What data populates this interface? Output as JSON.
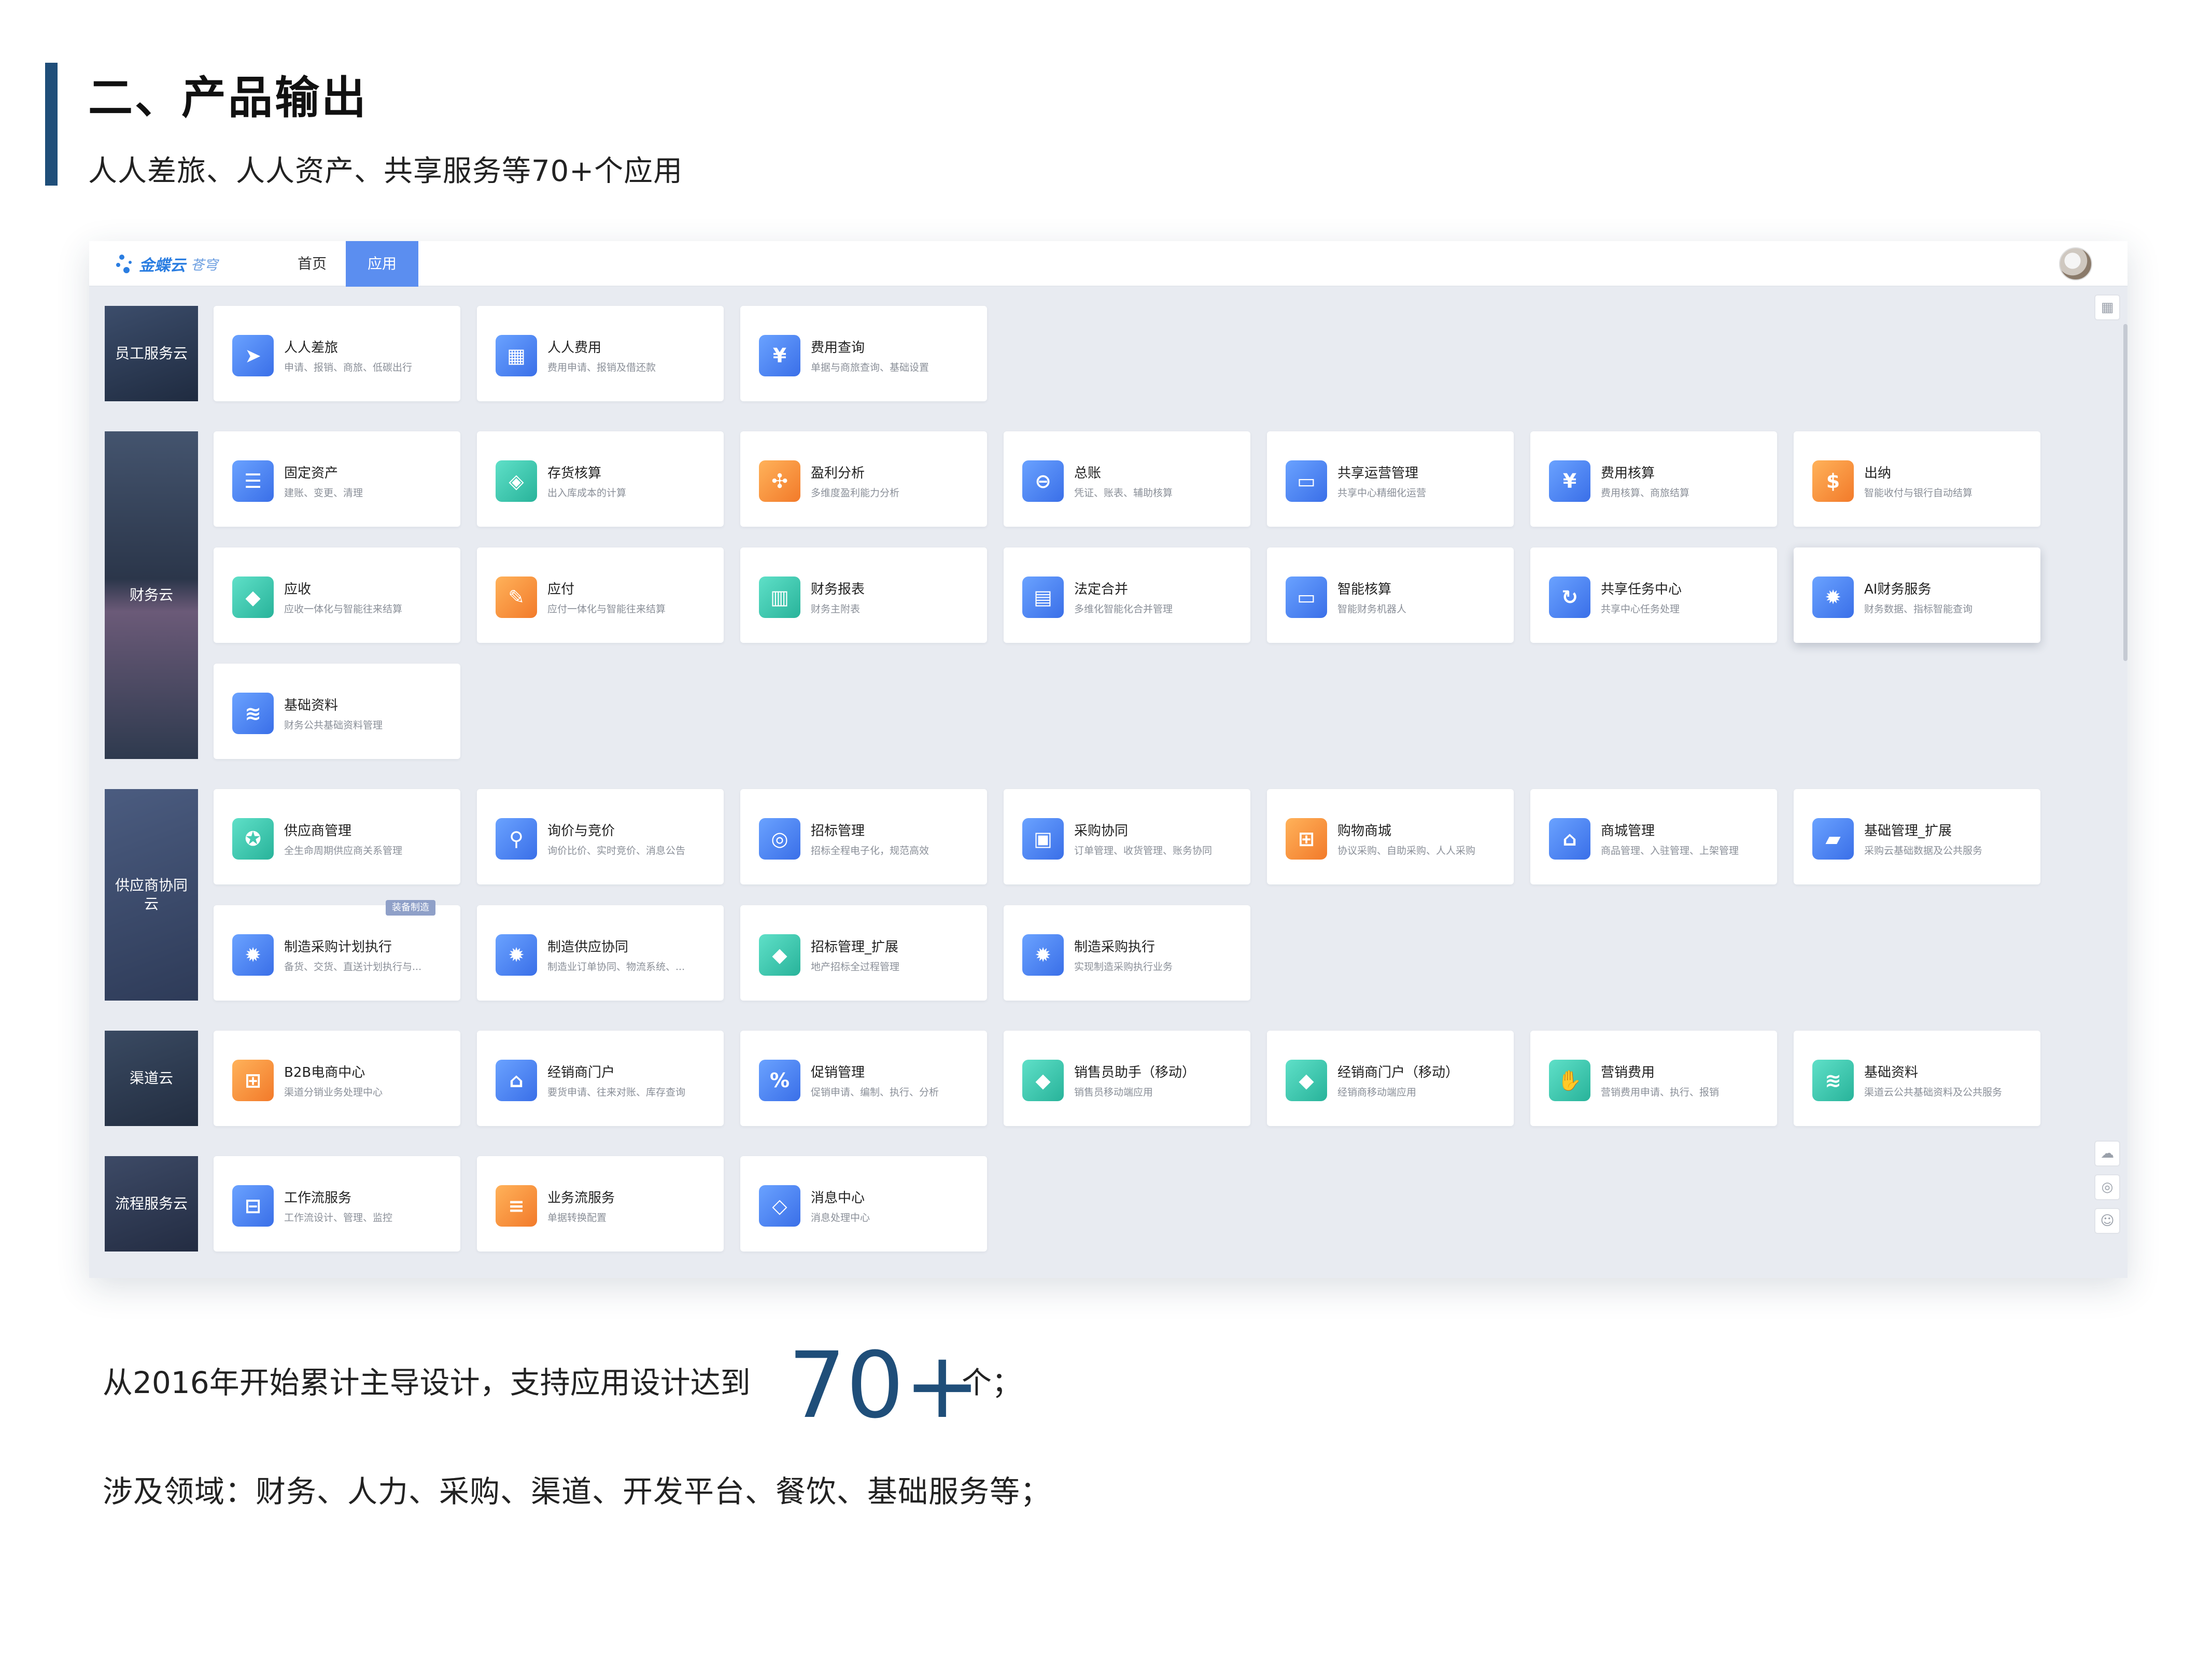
{
  "slide": {
    "title": "二、产品输出",
    "subtitle": "人人差旅、人人资产、共享服务等70+个应用"
  },
  "app": {
    "logo_text": "金蝶云",
    "logo_sub": "苍穹",
    "nav": {
      "home": "首页",
      "apps": "应用"
    },
    "accent_color": "#5b8ef0"
  },
  "sections": [
    {
      "label": "员工服务云",
      "cards": [
        {
          "name": "人人差旅",
          "desc": "申请、报销、商旅、低碳出行",
          "icon": "travel-icon",
          "color": "blue"
        },
        {
          "name": "人人费用",
          "desc": "费用申请、报销及借还款",
          "icon": "calculator-icon",
          "color": "blue"
        },
        {
          "name": "费用查询",
          "desc": "单据与商旅查询、基础设置",
          "icon": "document-yen-icon",
          "color": "blue"
        }
      ]
    },
    {
      "label": "财务云",
      "cards": [
        {
          "name": "固定资产",
          "desc": "建账、变更、清理",
          "icon": "list-icon",
          "color": "blue"
        },
        {
          "name": "存货核算",
          "desc": "出入库成本的计算",
          "icon": "box-icon",
          "color": "green"
        },
        {
          "name": "盈利分析",
          "desc": "多维度盈利能力分析",
          "icon": "network-icon",
          "color": "orange"
        },
        {
          "name": "总账",
          "desc": "凭证、账表、辅助核算",
          "icon": "ledger-icon",
          "color": "blue"
        },
        {
          "name": "共享运营管理",
          "desc": "共享中心精细化运营",
          "icon": "monitor-icon",
          "color": "blue"
        },
        {
          "name": "费用核算",
          "desc": "费用核算、商旅结算",
          "icon": "document-yen-icon",
          "color": "blue"
        },
        {
          "name": "出纳",
          "desc": "智能收付与银行自动结算",
          "icon": "money-bag-icon",
          "color": "orange"
        },
        {
          "name": "应收",
          "desc": "应收一体化与智能往来结算",
          "icon": "cube-icon",
          "color": "green"
        },
        {
          "name": "应付",
          "desc": "应付一体化与智能往来结算",
          "icon": "pen-paper-icon",
          "color": "orange"
        },
        {
          "name": "财务报表",
          "desc": "财务主附表",
          "icon": "chart-board-icon",
          "color": "green"
        },
        {
          "name": "法定合并",
          "desc": "多维化智能化合并管理",
          "icon": "report-icon",
          "color": "blue"
        },
        {
          "name": "智能核算",
          "desc": "智能财务机器人",
          "icon": "monitor-icon",
          "color": "blue"
        },
        {
          "name": "共享任务中心",
          "desc": "共享中心任务处理",
          "icon": "cycle-icon",
          "color": "blue"
        },
        {
          "name": "AI财务服务",
          "desc": "财务数据、指标智能查询",
          "icon": "gear-icon",
          "color": "blue"
        },
        {
          "name": "基础资料",
          "desc": "财务公共基础资料管理",
          "icon": "layers-icon",
          "color": "blue"
        }
      ]
    },
    {
      "label": "供应商协同云",
      "cards": [
        {
          "name": "供应商管理",
          "desc": "全生命周期供应商关系管理",
          "icon": "award-icon",
          "color": "green"
        },
        {
          "name": "询价与竞价",
          "desc": "询价比价、实时竞价、消息公告",
          "icon": "search-icon",
          "color": "blue"
        },
        {
          "name": "招标管理",
          "desc": "招标全程电子化，规范高效",
          "icon": "target-icon",
          "color": "blue"
        },
        {
          "name": "采购协同",
          "desc": "订单管理、收货管理、账务协同",
          "icon": "cart-board-icon",
          "color": "blue"
        },
        {
          "name": "购物商城",
          "desc": "协议采购、自助采购、人人采购",
          "icon": "cart-icon",
          "color": "orange"
        },
        {
          "name": "商城管理",
          "desc": "商品管理、入驻管理、上架管理",
          "icon": "store-icon",
          "color": "blue"
        },
        {
          "name": "基础管理_扩展",
          "desc": "采购云基础数据及公共服务",
          "icon": "folder-icon",
          "color": "blue"
        },
        {
          "name": "制造采购计划执行",
          "desc": "备货、交货、直送计划执行与...",
          "icon": "gear-icon",
          "color": "blue",
          "badge": "装备制造"
        },
        {
          "name": "制造供应协同",
          "desc": "制造业订单协同、物流系统、...",
          "icon": "gear-icon",
          "color": "blue"
        },
        {
          "name": "招标管理_扩展",
          "desc": "地产招标全过程管理",
          "icon": "cube-icon",
          "color": "green"
        },
        {
          "name": "制造采购执行",
          "desc": "实现制造采购执行业务",
          "icon": "gear-icon",
          "color": "blue"
        }
      ]
    },
    {
      "label": "渠道云",
      "cards": [
        {
          "name": "B2B电商中心",
          "desc": "渠道分销业务处理中心",
          "icon": "cart-icon",
          "color": "orange"
        },
        {
          "name": "经销商门户",
          "desc": "要货申请、往来对账、库存查询",
          "icon": "store-icon",
          "color": "blue"
        },
        {
          "name": "促销管理",
          "desc": "促销申请、编制、执行、分析",
          "icon": "percent-icon",
          "color": "blue"
        },
        {
          "name": "销售员助手（移动）",
          "desc": "销售员移动端应用",
          "icon": "cube-icon",
          "color": "green"
        },
        {
          "name": "经销商门户（移动）",
          "desc": "经销商移动端应用",
          "icon": "cube-icon",
          "color": "green"
        },
        {
          "name": "营销费用",
          "desc": "营销费用申请、执行、报销",
          "icon": "hand-money-icon",
          "color": "green"
        },
        {
          "name": "基础资料",
          "desc": "渠道云公共基础资料及公共服务",
          "icon": "layers-icon",
          "color": "green"
        }
      ]
    },
    {
      "label": "流程服务云",
      "cards": [
        {
          "name": "工作流服务",
          "desc": "工作流设计、管理、监控",
          "icon": "flow-icon",
          "color": "blue"
        },
        {
          "name": "业务流服务",
          "desc": "单据转换配置",
          "icon": "doc-flow-icon",
          "color": "orange"
        },
        {
          "name": "消息中心",
          "desc": "消息处理中心",
          "icon": "diamond-grid-icon",
          "color": "blue"
        }
      ]
    }
  ],
  "footer": {
    "stat_prefix": "从2016年开始累计主导设计，支持应用设计达到",
    "stat_number": "70+",
    "stat_unit": "个；",
    "domains": "涉及领域：财务、人力、采购、渠道、开发平台、餐饮、基础服务等；"
  }
}
